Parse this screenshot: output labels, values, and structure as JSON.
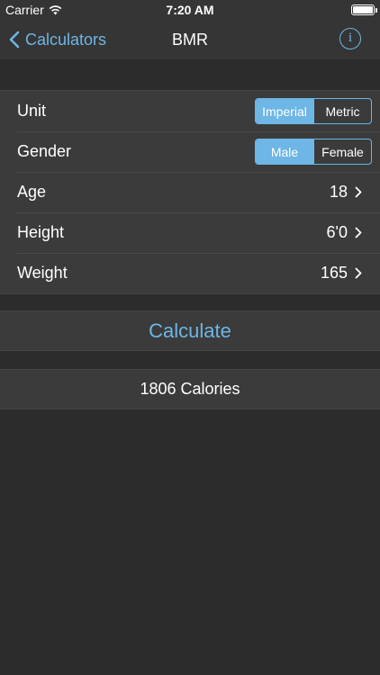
{
  "status_bar": {
    "carrier": "Carrier",
    "time": "7:20 AM"
  },
  "nav": {
    "back_label": "Calculators",
    "title": "BMR",
    "info_icon": "i"
  },
  "form": {
    "unit": {
      "label": "Unit",
      "options": [
        "Imperial",
        "Metric"
      ],
      "selected": "Imperial"
    },
    "gender": {
      "label": "Gender",
      "options": [
        "Male",
        "Female"
      ],
      "selected": "Male"
    },
    "age": {
      "label": "Age",
      "value": "18"
    },
    "height": {
      "label": "Height",
      "value": "6'0"
    },
    "weight": {
      "label": "Weight",
      "value": "165"
    }
  },
  "calculate_label": "Calculate",
  "result": "1806 Calories",
  "colors": {
    "accent": "#6db6e6",
    "background": "#2c2c2c",
    "cell": "#3b3b3b"
  }
}
